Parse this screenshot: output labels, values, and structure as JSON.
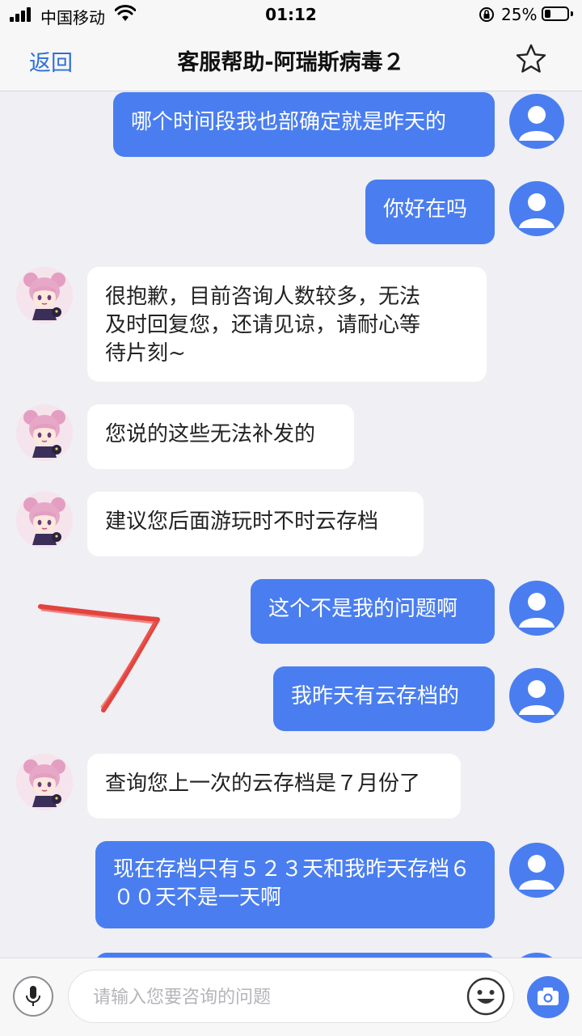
{
  "status_bar": {
    "carrier": "中国移动",
    "time": "01:12",
    "battery_percent": "25%",
    "battery_level": 0.25,
    "icons": [
      "signal-icon",
      "wifi-icon",
      "orientation-lock-icon",
      "battery-icon"
    ]
  },
  "nav": {
    "back_label": "返回",
    "title": "客服帮助-阿瑞斯病毒２",
    "star_icon": "star-icon"
  },
  "messages": [
    {
      "from": "user",
      "text": "哪个时间段我也部确定就是昨天的"
    },
    {
      "from": "user",
      "text": "你好在吗"
    },
    {
      "from": "agent",
      "text": "很抱歉，目前咨询人数较多，无法\n及时回复您，还请见谅，请耐心等\n待片刻~"
    },
    {
      "from": "agent",
      "text": "您说的这些无法补发的"
    },
    {
      "from": "agent",
      "text": "建议您后面游玩时不时云存档"
    },
    {
      "from": "user",
      "text": "这个不是我的问题啊"
    },
    {
      "from": "user",
      "text": "我昨天有云存档的"
    },
    {
      "from": "agent",
      "text": "查询您上一次的云存档是７月份了"
    },
    {
      "from": "user",
      "text": "现在存档只有５２３天和我昨天存档６\n００天不是一天啊"
    }
  ],
  "input": {
    "placeholder": "请输入您要咨询的问题",
    "value": ""
  },
  "colors": {
    "accent": "#4a7ef0",
    "link": "#2f6fd8",
    "annotation": "#e0302a",
    "background": "#efeff4"
  }
}
